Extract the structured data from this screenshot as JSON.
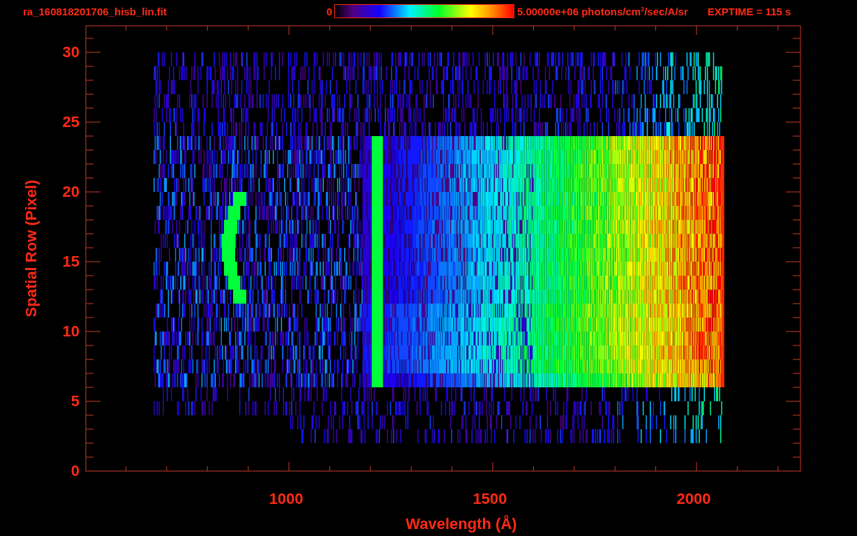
{
  "title": "ra_160818201706_hisb_lin.fit",
  "colorbar": {
    "min_label": "0",
    "max_label": "5.00000e+06 photons/cm$^{2}$/sec/A/sr"
  },
  "exposure": "EXPTIME = 115 s",
  "plot": {
    "xlabel": "Wavelength (Å)",
    "ylabel": "Spatial Row (Pixel)",
    "xtick_labels": [
      "1000",
      "1500",
      "2000"
    ],
    "ytick_labels": [
      "30",
      "25",
      "20",
      "15",
      "10",
      "5",
      "0"
    ]
  }
}
